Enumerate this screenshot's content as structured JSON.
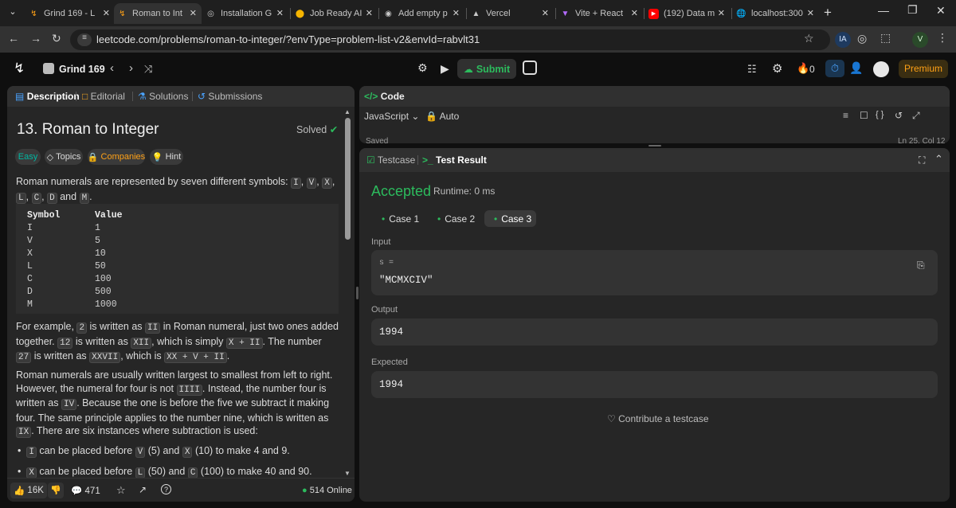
{
  "browser": {
    "tabs": [
      {
        "title": "Grind 169 - L",
        "icon": "leetcode-icon"
      },
      {
        "title": "Roman to Int",
        "icon": "leetcode-icon"
      },
      {
        "title": "Installation G",
        "icon": "openai-icon"
      },
      {
        "title": "Job Ready AI",
        "icon": "app-icon"
      },
      {
        "title": "Add empty p",
        "icon": "github-icon"
      },
      {
        "title": "Vercel",
        "icon": "vercel-icon"
      },
      {
        "title": "Vite + React",
        "icon": "vite-icon"
      },
      {
        "title": "(192) Data m",
        "icon": "youtube-icon"
      },
      {
        "title": "localhost:300",
        "icon": "globe-icon"
      }
    ],
    "url": "leetcode.com/problems/roman-to-integer/?envType=problem-list-v2&envId=rabvlt31",
    "profile_initials": "IA",
    "profile_v": "V"
  },
  "header": {
    "list_name": "Grind 169",
    "submit_label": "Submit",
    "streak_count": "0",
    "premium_label": "Premium"
  },
  "description": {
    "tabs": [
      "Description",
      "Editorial",
      "Solutions",
      "Submissions"
    ],
    "title": "13. Roman to Integer",
    "solved_label": "Solved",
    "chips": [
      "Easy",
      "Topics",
      "Companies",
      "Hint"
    ],
    "intro": "Roman numerals are represented by seven different symbols:",
    "symbols_codes": [
      "I",
      "V",
      "X",
      "L",
      "C",
      "D"
    ],
    "and_text": "and",
    "last_symbol": "M",
    "table_headers": [
      "Symbol",
      "Value"
    ],
    "table_rows": [
      [
        "I",
        "1"
      ],
      [
        "V",
        "5"
      ],
      [
        "X",
        "10"
      ],
      [
        "L",
        "50"
      ],
      [
        "C",
        "100"
      ],
      [
        "D",
        "500"
      ],
      [
        "M",
        "1000"
      ]
    ],
    "example_p": {
      "a": "For example,",
      "c1": "2",
      "b": "is written as",
      "c2": "II",
      "d": "in Roman numeral, just two ones added together.",
      "c3": "12",
      "e": "is written as",
      "c4": "XII",
      "f": ", which is simply",
      "c5": "X + II",
      "g": ". The number",
      "c6": "27",
      "h": "is written as",
      "c7": "XXVII",
      "i": ", which is",
      "c8": "XX + V + II",
      "j": "."
    },
    "para2_a": "Roman numerals are usually written largest to smallest from left to right. However, the numeral for four is not",
    "para2_c1": "IIII",
    "para2_b": ". Instead, the number four is written as",
    "para2_c2": "IV",
    "para2_c": ". Because the one is before the five we subtract it making four. The same principle applies to the number nine, which is written as",
    "para2_c3": "IX",
    "para2_d": ". There are six instances where subtraction is used:",
    "bullet1": {
      "c1": "I",
      "a": "can be placed before",
      "c2": "V",
      "b": "(5) and",
      "c3": "X",
      "c": "(10) to make 4 and 9."
    },
    "bullet2": {
      "c1": "X",
      "a": "can be placed before",
      "c2": "L",
      "b": "(50) and",
      "c3": "C",
      "c": "(100) to make 40 and 90."
    },
    "footer": {
      "likes": "16K",
      "comments": "471",
      "online": "514 Online"
    }
  },
  "code": {
    "tab_label": "Code",
    "language": "JavaScript",
    "auto_label": "Auto",
    "saved_label": "Saved",
    "cursor_pos": "Ln 25, Col 12"
  },
  "result": {
    "tabs": [
      "Testcase",
      "Test Result"
    ],
    "status": "Accepted",
    "runtime": "Runtime: 0 ms",
    "cases": [
      "Case 1",
      "Case 2",
      "Case 3"
    ],
    "input_label": "Input",
    "var_label": "s =",
    "input_value": "\"MCMXCIV\"",
    "output_label": "Output",
    "output_value": "1994",
    "expected_label": "Expected",
    "expected_value": "1994",
    "contribute_label": "Contribute a testcase"
  },
  "colors": {
    "accepted": "#2cbb5d",
    "easy": "#00b8a3",
    "companies": "#ffa116",
    "premium": "#ffa116"
  }
}
